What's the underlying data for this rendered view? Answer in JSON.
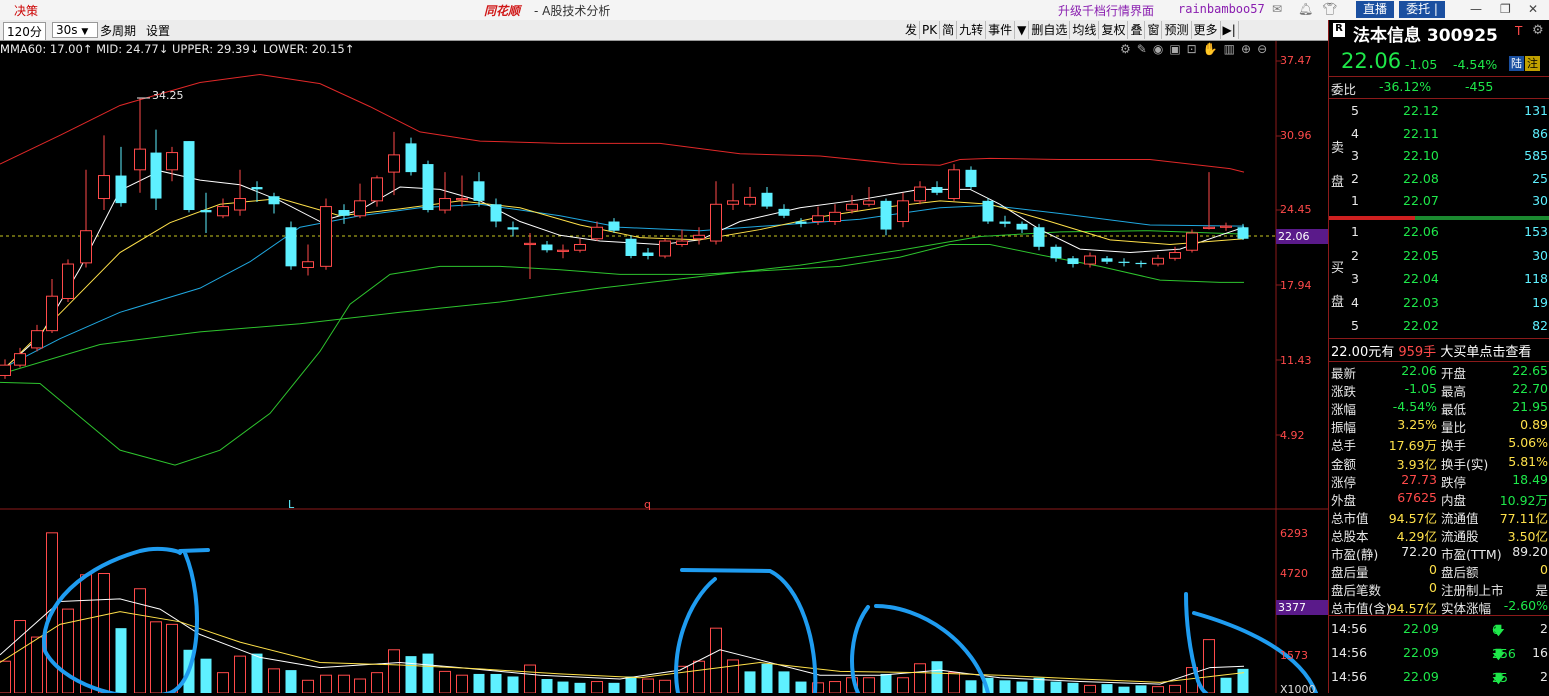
{
  "titlebar": {
    "left_label": "决策",
    "app_name": "同花顺",
    "app_subtitle": "- A股技术分析",
    "upgrade_link": "升级千档行情界面",
    "username": "rainbamboo57",
    "direct_button": "直播",
    "entrust_button": "委托 |"
  },
  "toolbar": {
    "period": "120分",
    "interval": "30s",
    "multi_period": "多周期",
    "settings": "设置",
    "right_items": [
      "发",
      "PK",
      "简",
      "九转",
      "事件",
      "▼",
      "删自选",
      "均线",
      "复权",
      "叠",
      "窗",
      "预测",
      "更多",
      "▶|"
    ],
    "indicator_line": "MA60: 17.00↑ MID: 24.77↓ UPPER: 29.39↓ LOWER: 20.15↑"
  },
  "chart": {
    "price_axis": [
      "37.47",
      "30.96",
      "24.45",
      "17.94",
      "11.43",
      "4.92"
    ],
    "current_price_tag": "22.06",
    "high_marker": "34.25",
    "marker_L": "L",
    "marker_q": "q",
    "volume_axis": [
      "6293",
      "4720",
      "1573",
      "X1000"
    ],
    "volume_tag": "3377"
  },
  "stock": {
    "r_badge": "R",
    "name_code": "法本信息 300925",
    "t_badge": "T",
    "price": "22.06",
    "change": "-1.05",
    "change_pct": "-4.54%",
    "badge_lu": "陆",
    "badge_zhu": "注",
    "weibi_label": "委比",
    "weibi_pct": "-36.12%",
    "weibi_diff": "-455"
  },
  "order_book": {
    "sell_label": [
      "卖",
      "盘"
    ],
    "buy_label": [
      "买",
      "盘"
    ],
    "asks": [
      {
        "level": "5",
        "price": "22.12",
        "vol": "131"
      },
      {
        "level": "4",
        "price": "22.11",
        "vol": "86"
      },
      {
        "level": "3",
        "price": "22.10",
        "vol": "585"
      },
      {
        "level": "2",
        "price": "22.08",
        "vol": "25"
      },
      {
        "level": "1",
        "price": "22.07",
        "vol": "30"
      }
    ],
    "bids": [
      {
        "level": "1",
        "price": "22.06",
        "vol": "153"
      },
      {
        "level": "2",
        "price": "22.05",
        "vol": "30"
      },
      {
        "level": "3",
        "price": "22.04",
        "vol": "118"
      },
      {
        "level": "4",
        "price": "22.03",
        "vol": "19"
      },
      {
        "level": "5",
        "price": "22.02",
        "vol": "82"
      }
    ]
  },
  "big_order": {
    "price_text": "22.00元有",
    "qty_text": "959手",
    "action_text": "大买单点击查看"
  },
  "stats": [
    {
      "l1": "最新",
      "v1": "22.06",
      "c1": "green",
      "l2": "开盘",
      "v2": "22.65",
      "c2": "green"
    },
    {
      "l1": "涨跌",
      "v1": "-1.05",
      "c1": "green",
      "l2": "最高",
      "v2": "22.70",
      "c2": "green"
    },
    {
      "l1": "涨幅",
      "v1": "-4.54%",
      "c1": "green",
      "l2": "最低",
      "v2": "21.95",
      "c2": "green"
    },
    {
      "l1": "振幅",
      "v1": "3.25%",
      "c1": "yellow",
      "l2": "量比",
      "v2": "0.89",
      "c2": "yellow"
    },
    {
      "l1": "总手",
      "v1": "17.69万",
      "c1": "yellow",
      "l2": "换手",
      "v2": "5.06%",
      "c2": "yellow"
    },
    {
      "l1": "金额",
      "v1": "3.93亿",
      "c1": "yellow",
      "l2": "换手(实)",
      "v2": "5.81%",
      "c2": "yellow"
    },
    {
      "l1": "涨停",
      "v1": "27.73",
      "c1": "red",
      "l2": "跌停",
      "v2": "18.49",
      "c2": "green"
    },
    {
      "l1": "外盘",
      "v1": "67625",
      "c1": "red",
      "l2": "内盘",
      "v2": "10.92万",
      "c2": "green"
    },
    {
      "l1": "总市值",
      "v1": "94.57亿",
      "c1": "yellow",
      "l2": "流通值",
      "v2": "77.11亿",
      "c2": "yellow"
    },
    {
      "l1": "总股本",
      "v1": "4.29亿",
      "c1": "yellow",
      "l2": "流通股",
      "v2": "3.50亿",
      "c2": "yellow"
    },
    {
      "l1": "市盈(静)",
      "v1": "72.20",
      "c1": "white",
      "l2": "市盈(TTM)",
      "v2": "89.20",
      "c2": "white"
    },
    {
      "l1": "盘后量",
      "v1": "0",
      "c1": "yellow",
      "l2": "盘后额",
      "v2": "0",
      "c2": "yellow"
    },
    {
      "l1": "盘后笔数",
      "v1": "0",
      "c1": "yellow",
      "l2": "注册制上市",
      "v2": "是",
      "c2": "white"
    },
    {
      "l1": "总市值(含)",
      "v1": "94.57亿",
      "c1": "yellow",
      "l2": "实体涨幅",
      "v2": "-2.60%",
      "c2": "green"
    }
  ],
  "ticks": [
    {
      "time": "14:56",
      "price": "22.09",
      "vol": "6",
      "count": "2"
    },
    {
      "time": "14:56",
      "price": "22.09",
      "vol": "256",
      "count": "16"
    },
    {
      "time": "14:56",
      "price": "22.09",
      "vol": "25",
      "count": "2"
    }
  ],
  "colors": {
    "up": "#ff4a4a",
    "down": "#5ef0ff",
    "upper": "#e02828",
    "lower": "#2ec42e",
    "ma_white": "#ffffff",
    "ma_yellow": "#ffe14a",
    "annotation": "#1f9cf0"
  }
}
